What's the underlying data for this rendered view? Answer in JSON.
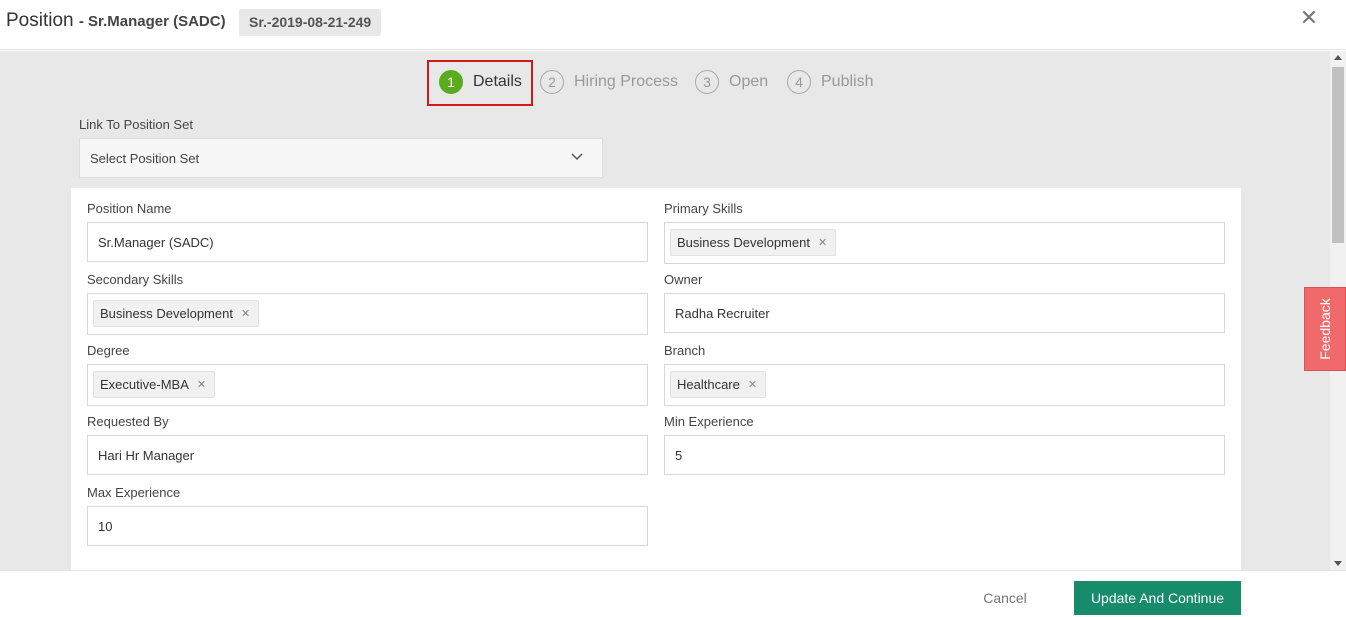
{
  "header": {
    "title": "Position",
    "subtitle": "- Sr.Manager (SADC)",
    "reference": "Sr.-2019-08-21-249",
    "close_icon": "close-icon"
  },
  "steps": [
    {
      "number": "1",
      "label": "Details",
      "active": true
    },
    {
      "number": "2",
      "label": "Hiring Process",
      "active": false
    },
    {
      "number": "3",
      "label": "Open",
      "active": false
    },
    {
      "number": "4",
      "label": "Publish",
      "active": false
    }
  ],
  "position_set": {
    "label": "Link To Position Set",
    "placeholder": "Select Position Set"
  },
  "form": {
    "position_name": {
      "label": "Position Name",
      "value": "Sr.Manager (SADC)"
    },
    "primary_skills": {
      "label": "Primary Skills",
      "tags": [
        "Business Development"
      ]
    },
    "secondary_skills": {
      "label": "Secondary Skills",
      "tags": [
        "Business Development"
      ]
    },
    "owner": {
      "label": "Owner",
      "value": "Radha Recruiter"
    },
    "degree": {
      "label": "Degree",
      "tags": [
        "Executive-MBA"
      ]
    },
    "branch": {
      "label": "Branch",
      "tags": [
        "Healthcare"
      ]
    },
    "requested_by": {
      "label": "Requested By",
      "value": "Hari Hr Manager"
    },
    "min_experience": {
      "label": "Min Experience",
      "value": "5"
    },
    "max_experience": {
      "label": "Max Experience",
      "value": "10"
    }
  },
  "feedback": {
    "label": "Feedback"
  },
  "footer": {
    "cancel_label": "Cancel",
    "primary_label": "Update And Continue"
  },
  "colors": {
    "active_step": "#5bab1e",
    "highlight_border": "#d4171c",
    "primary_button": "#168c6a",
    "feedback_tab": "#f06a6c"
  }
}
